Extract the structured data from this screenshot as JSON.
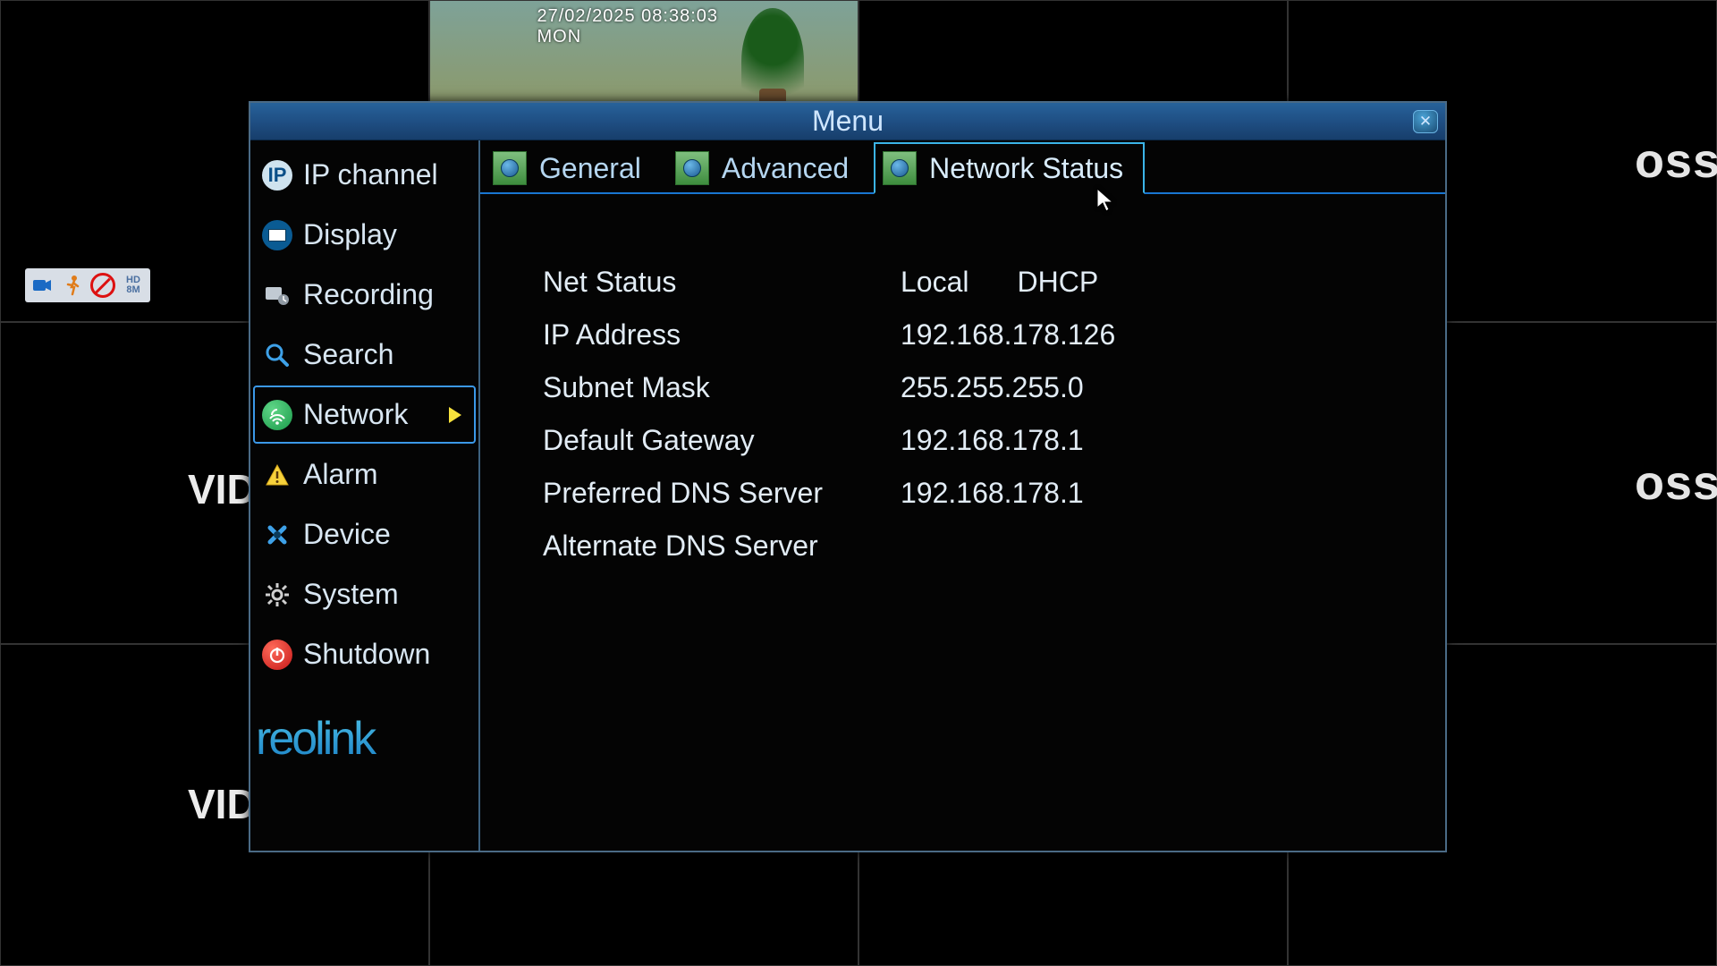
{
  "background": {
    "grid_label": "VID",
    "loss_fragment": "oss",
    "preview_timestamp": "27/02/2025 08:38:03 MON",
    "badges": {
      "hd_top": "HD",
      "hd_bottom": "8M"
    }
  },
  "dialog": {
    "title": "Menu"
  },
  "sidebar": {
    "items": [
      {
        "id": "ip-channel",
        "label": "IP channel",
        "icon": "ip-icon"
      },
      {
        "id": "display",
        "label": "Display",
        "icon": "display-icon"
      },
      {
        "id": "recording",
        "label": "Recording",
        "icon": "recording-icon"
      },
      {
        "id": "search",
        "label": "Search",
        "icon": "search-icon"
      },
      {
        "id": "network",
        "label": "Network",
        "icon": "network-icon",
        "active": true
      },
      {
        "id": "alarm",
        "label": "Alarm",
        "icon": "alarm-icon"
      },
      {
        "id": "device",
        "label": "Device",
        "icon": "device-icon"
      },
      {
        "id": "system",
        "label": "System",
        "icon": "system-icon"
      },
      {
        "id": "shutdown",
        "label": "Shutdown",
        "icon": "shutdown-icon"
      }
    ],
    "brand": "reolink"
  },
  "tabs": [
    {
      "id": "general",
      "label": "General"
    },
    {
      "id": "advanced",
      "label": "Advanced"
    },
    {
      "id": "network-status",
      "label": "Network Status",
      "active": true
    }
  ],
  "network_status": {
    "rows": [
      {
        "label": "Net Status",
        "value1": "Local",
        "value2": "DHCP"
      },
      {
        "label": "IP Address",
        "value": "192.168.178.126"
      },
      {
        "label": "Subnet Mask",
        "value": "255.255.255.0"
      },
      {
        "label": "Default Gateway",
        "value": "192.168.178.1"
      },
      {
        "label": "Preferred DNS Server",
        "value": "192.168.178.1"
      },
      {
        "label": "Alternate DNS Server",
        "value": ""
      }
    ]
  }
}
